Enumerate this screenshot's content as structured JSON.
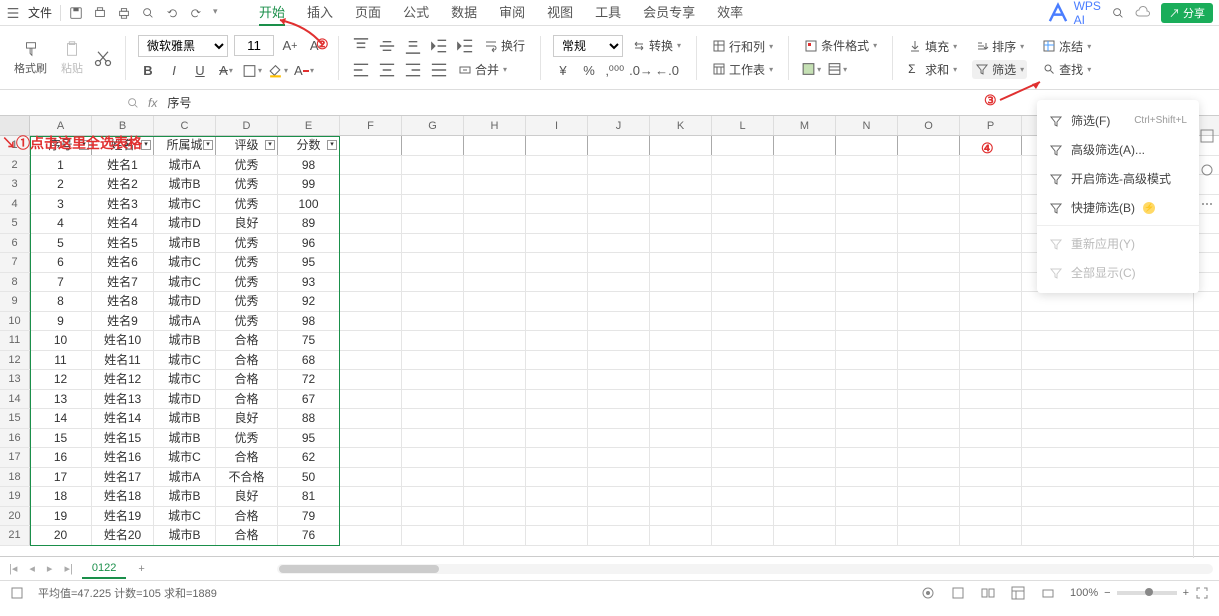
{
  "titlebar": {
    "file_label": "文件",
    "wps_ai": "WPS AI",
    "share": "分享"
  },
  "tabs": [
    "开始",
    "插入",
    "页面",
    "公式",
    "数据",
    "审阅",
    "视图",
    "工具",
    "会员专享",
    "效率"
  ],
  "active_tab": 0,
  "ribbon": {
    "format_painter": "格式刷",
    "paste": "粘贴",
    "font_name": "微软雅黑",
    "font_size": "11",
    "number_format": "常规",
    "wrap": "换行",
    "transpose": "转换",
    "merge": "合并",
    "rows_cols": "行和列",
    "worksheet": "工作表",
    "cond_format": "条件格式",
    "fill": "填充",
    "sum": "求和",
    "sort": "排序",
    "freeze": "冻结",
    "filter": "筛选",
    "find": "查找"
  },
  "formula_bar": {
    "fx": "fx",
    "value": "序号"
  },
  "columns": [
    "A",
    "B",
    "C",
    "D",
    "E",
    "F",
    "G",
    "H",
    "I",
    "J",
    "K",
    "L",
    "M",
    "N",
    "O",
    "P"
  ],
  "headers": [
    "序号",
    "姓名",
    "所属城",
    "评级",
    "分数"
  ],
  "rows": [
    [
      1,
      "姓名1",
      "城市A",
      "优秀",
      98
    ],
    [
      2,
      "姓名2",
      "城市B",
      "优秀",
      99
    ],
    [
      3,
      "姓名3",
      "城市C",
      "优秀",
      100
    ],
    [
      4,
      "姓名4",
      "城市D",
      "良好",
      89
    ],
    [
      5,
      "姓名5",
      "城市B",
      "优秀",
      96
    ],
    [
      6,
      "姓名6",
      "城市C",
      "优秀",
      95
    ],
    [
      7,
      "姓名7",
      "城市C",
      "优秀",
      93
    ],
    [
      8,
      "姓名8",
      "城市D",
      "优秀",
      92
    ],
    [
      9,
      "姓名9",
      "城市A",
      "优秀",
      98
    ],
    [
      10,
      "姓名10",
      "城市B",
      "合格",
      75
    ],
    [
      11,
      "姓名11",
      "城市C",
      "合格",
      68
    ],
    [
      12,
      "姓名12",
      "城市C",
      "合格",
      72
    ],
    [
      13,
      "姓名13",
      "城市D",
      "合格",
      67
    ],
    [
      14,
      "姓名14",
      "城市B",
      "良好",
      88
    ],
    [
      15,
      "姓名15",
      "城市B",
      "优秀",
      95
    ],
    [
      16,
      "姓名16",
      "城市C",
      "合格",
      62
    ],
    [
      17,
      "姓名17",
      "城市A",
      "不合格",
      50
    ],
    [
      18,
      "姓名18",
      "城市B",
      "良好",
      81
    ],
    [
      19,
      "姓名19",
      "城市C",
      "合格",
      79
    ],
    [
      20,
      "姓名20",
      "城市B",
      "合格",
      76
    ]
  ],
  "annotations": {
    "step1": "①点击这里全选表格",
    "step2": "②",
    "step3": "③",
    "step4": "④"
  },
  "filter_menu": {
    "items": [
      {
        "label": "筛选(F)",
        "shortcut": "Ctrl+Shift+L",
        "enabled": true
      },
      {
        "label": "高级筛选(A)...",
        "enabled": true
      },
      {
        "label": "开启筛选-高级模式",
        "enabled": true
      },
      {
        "label": "快捷筛选(B)",
        "badge": true,
        "enabled": true
      },
      {
        "label": "重新应用(Y)",
        "enabled": false
      },
      {
        "label": "全部显示(C)",
        "enabled": false
      }
    ]
  },
  "sheet_tabs": {
    "active": "0122",
    "add": "+"
  },
  "status_bar": {
    "stats": "平均值=47.225  计数=105  求和=1889",
    "zoom": "100%"
  }
}
